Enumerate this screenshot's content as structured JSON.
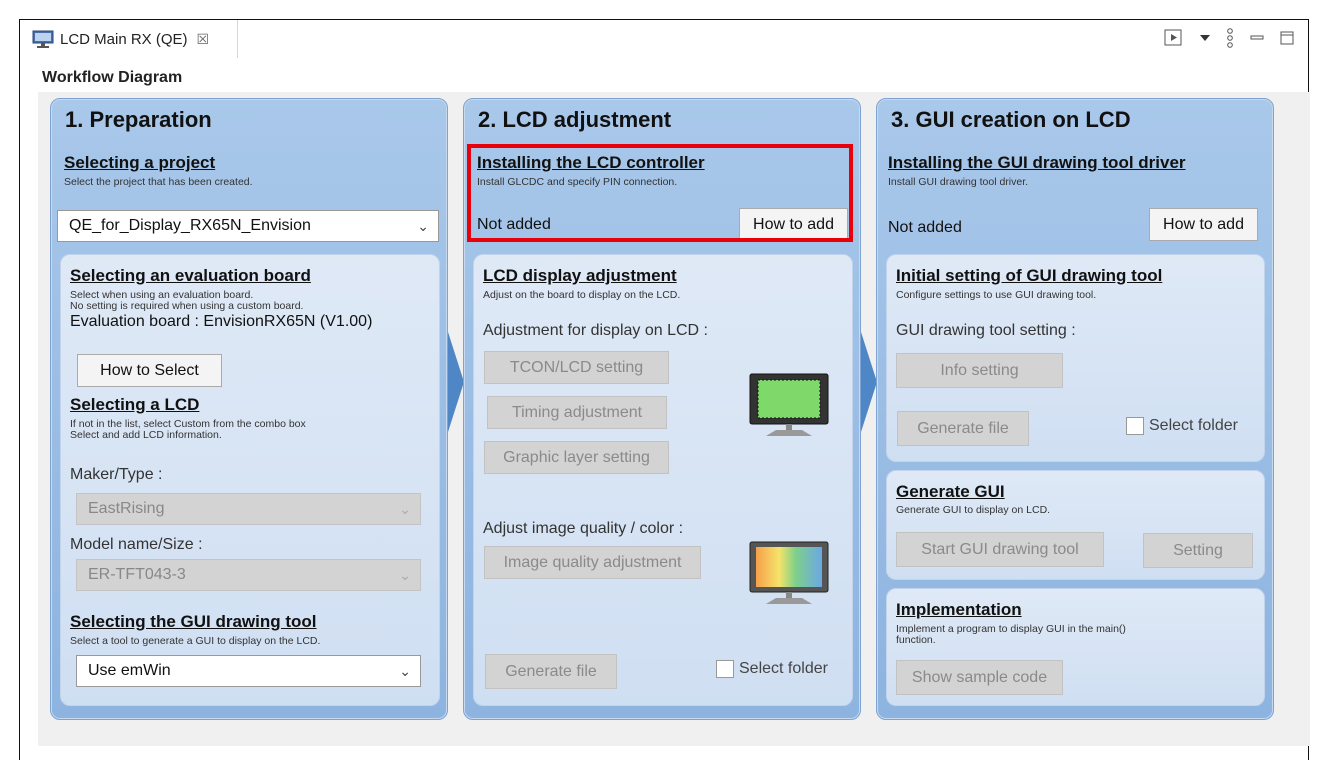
{
  "tab": {
    "title": "LCD Main RX (QE)",
    "close_symbol": "☒",
    "icon": "monitor-icon"
  },
  "toolbar": {
    "icons": [
      "run-view-icon",
      "dropdown-arrow-icon",
      "more-icon",
      "minimize-icon",
      "maximize-icon"
    ]
  },
  "workflow_title": "Workflow Diagram",
  "col1": {
    "title": "1. Preparation",
    "project": {
      "title": "Selecting a project",
      "desc": "Select the project that has been created.",
      "value": "QE_for_Display_RX65N_Envision"
    },
    "board": {
      "title": "Selecting an evaluation board",
      "desc1": "Select when using an evaluation board.",
      "desc2": "No setting is required when using a custom board.",
      "value_line": "Evaluation board : EnvisionRX65N (V1.00)",
      "button": "How to Select"
    },
    "lcd": {
      "title": "Selecting a LCD",
      "desc1": "If not in the list, select Custom from the combo box",
      "desc2": "Select and add LCD information.",
      "maker_label": "Maker/Type :",
      "maker_value": "EastRising",
      "model_label": "Model name/Size :",
      "model_value": "ER-TFT043-3"
    },
    "gui_tool": {
      "title": "Selecting the GUI drawing tool",
      "desc": "Select a tool to generate a GUI to display on the LCD.",
      "value": "Use emWin"
    }
  },
  "col2": {
    "title": "2. LCD adjustment",
    "controller": {
      "title": "Installing the LCD controller",
      "desc": "Install GLCDC and specify PIN connection.",
      "status": "Not added",
      "button": "How to add"
    },
    "display": {
      "title": "LCD display adjustment",
      "desc": "Adjust on the board to display on the LCD.",
      "label": "Adjustment for display on LCD :",
      "btn_tcon": "TCON/LCD setting",
      "btn_timing": "Timing adjustment",
      "btn_layer": "Graphic layer setting",
      "quality_label": "Adjust image quality / color :",
      "btn_quality": "Image quality adjustment",
      "btn_generate": "Generate file",
      "select_folder": "Select folder"
    }
  },
  "col3": {
    "title": "3. GUI creation on LCD",
    "driver": {
      "title": "Installing the GUI drawing tool driver",
      "desc": "Install GUI drawing tool driver.",
      "status": "Not added",
      "button": "How to add"
    },
    "initial": {
      "title": "Initial setting of GUI drawing tool",
      "desc": "Configure settings to use GUI drawing tool.",
      "label": "GUI drawing tool setting :",
      "btn_info": "Info setting",
      "btn_generate": "Generate file",
      "select_folder": "Select folder"
    },
    "generate_gui": {
      "title": "Generate GUI",
      "desc": "Generate GUI to display on LCD.",
      "btn_start": "Start GUI drawing tool",
      "btn_setting": "Setting"
    },
    "implementation": {
      "title": "Implementation",
      "desc1": "Implement a program to display GUI in the main()",
      "desc2": "function.",
      "btn_sample": "Show sample code"
    }
  },
  "colors": {
    "highlight": "#e8000b",
    "panel": "#9dbee6",
    "inner": "#d8e5f5"
  }
}
